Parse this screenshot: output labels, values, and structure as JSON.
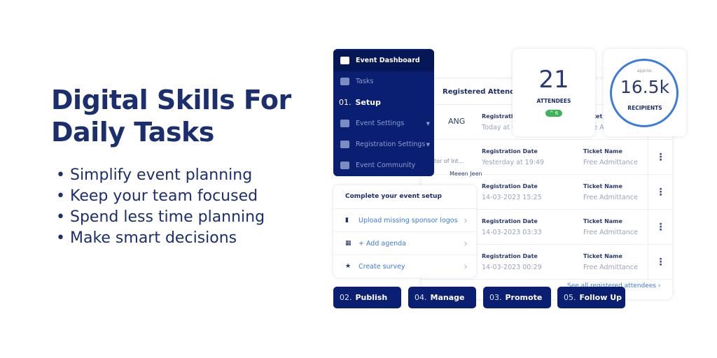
{
  "headline": {
    "title_line1": "Digital Skills For",
    "title_line2": "Daily Tasks",
    "bullets": [
      "Simplify event planning",
      "Keep your team focused",
      "Spend less time planning",
      "Make smart decisions"
    ]
  },
  "attendees": {
    "title": "Registered Attendees",
    "rows": [
      {
        "name": "ANG",
        "date_label": "Registration Date",
        "date": "Today at 0",
        "ticket_label": "Ticket Name",
        "ticket": "Free Admittance"
      },
      {
        "name": "tor of Int...",
        "date_label": "Registration Date",
        "date": "Yesterday at 19:49",
        "ticket_label": "Ticket Name",
        "ticket": "Free Admittance"
      },
      {
        "name": "Meeen Jeen",
        "date_label": "Registration Date",
        "date": "14-03-2023 15:25",
        "ticket_label": "Ticket Name",
        "ticket": "Free Admittance"
      },
      {
        "name": "",
        "date_label": "Registration Date",
        "date": "14-03-2023 03:33",
        "ticket_label": "Ticket Name",
        "ticket": "Free Admittance"
      },
      {
        "name": "",
        "date_label": "Registration Date",
        "date": "14-03-2023 00:29",
        "ticket_label": "Ticket Name",
        "ticket": "Free Admittance"
      }
    ],
    "see_all": "See all registered attendees ›"
  },
  "sidebar": {
    "items": [
      {
        "label": "Event Dashboard",
        "icon": "dashboard-icon"
      },
      {
        "label": "Tasks",
        "icon": "tasks-icon"
      },
      {
        "num": "01.",
        "label": "Setup"
      },
      {
        "label": "Event Settings",
        "icon": "settings-calendar-icon"
      },
      {
        "label": "Registration Settings",
        "icon": "calendar-check-icon"
      },
      {
        "label": "Event Community",
        "icon": "community-icon"
      }
    ]
  },
  "stats": {
    "attendees_value": "21",
    "attendees_label": "ATTENDEES",
    "attendees_delta": "^ 6",
    "recipients_prefix": "approx.",
    "recipients_value": "16.5k",
    "recipients_label": "RECIPIENTS"
  },
  "setup": {
    "title": "Complete your event setup",
    "items": [
      "Upload missing sponsor logos",
      "+ Add agenda",
      "Create survey"
    ]
  },
  "steps": [
    {
      "num": "02.",
      "label": "Publish"
    },
    {
      "num": "04.",
      "label": "Manage"
    },
    {
      "num": "03.",
      "label": "Promote"
    },
    {
      "num": "05.",
      "label": "Follow Up"
    }
  ],
  "colors": {
    "navy": "#0b1f72",
    "accent_blue": "#3b7be0",
    "green": "#3cb55a"
  }
}
